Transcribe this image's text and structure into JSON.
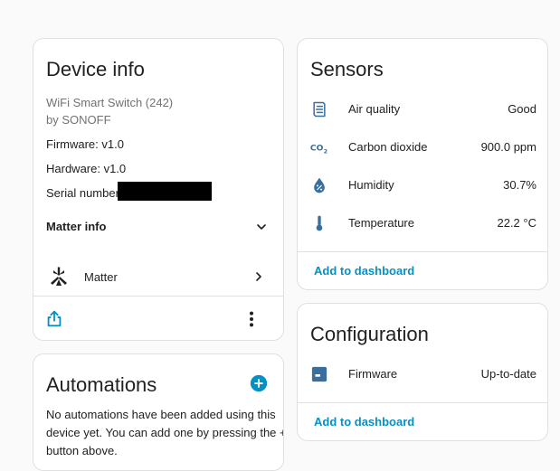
{
  "device_info": {
    "title": "Device info",
    "model": "WiFi Smart Switch (242)",
    "manufacturer": "by SONOFF",
    "firmware": "Firmware: v1.0",
    "hardware": "Hardware: v1.0",
    "serial_label": "Serial number:",
    "matter_info_label": "Matter info",
    "matter_label": "Matter"
  },
  "sensors": {
    "title": "Sensors",
    "rows": [
      {
        "icon": "air-filter-icon",
        "label": "Air quality",
        "value": "Good"
      },
      {
        "icon": "molecule-co2-icon",
        "label": "Carbon dioxide",
        "value": "900.0 ppm"
      },
      {
        "icon": "water-percent-icon",
        "label": "Humidity",
        "value": "30.7%"
      },
      {
        "icon": "thermometer-icon",
        "label": "Temperature",
        "value": "22.2 °C"
      }
    ],
    "add_to_dashboard": "Add to dashboard"
  },
  "configuration": {
    "title": "Configuration",
    "firmware_label": "Firmware",
    "firmware_value": "Up-to-date",
    "add_to_dashboard": "Add to dashboard"
  },
  "automations": {
    "title": "Automations",
    "empty_text_1": "No automations have been added using this",
    "empty_text_2": "device yet. You can add one by pressing the +",
    "empty_text_3": "button above."
  },
  "colors": {
    "accent": "#0590c5",
    "icon": "#3a6e9c",
    "text": "#212121",
    "secondary_text": "#727272"
  }
}
